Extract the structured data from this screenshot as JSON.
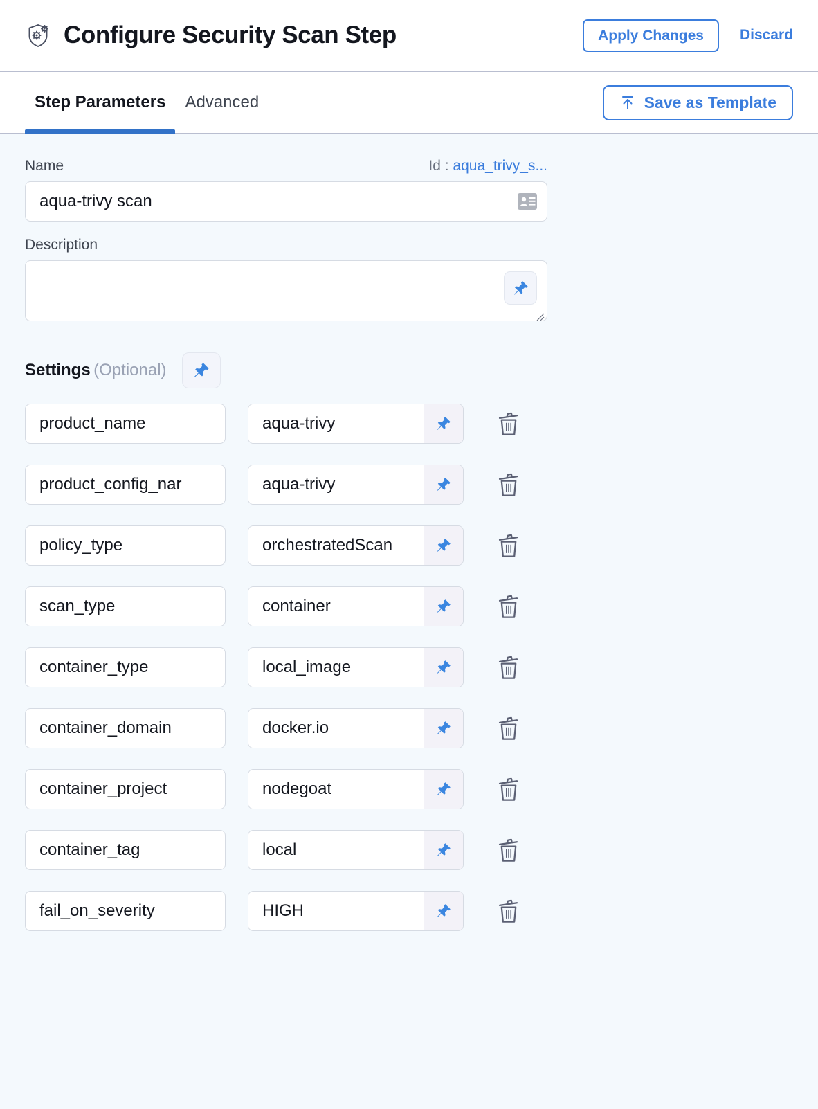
{
  "header": {
    "icon": "shield-gear-icon",
    "title": "Configure Security Scan Step",
    "apply_label": "Apply Changes",
    "discard_label": "Discard"
  },
  "tabbar": {
    "tabs": [
      {
        "label": "Step Parameters",
        "active": true
      },
      {
        "label": "Advanced",
        "active": false
      }
    ],
    "save_template_label": "Save as Template",
    "save_template_icon": "upload-to-top-icon"
  },
  "form": {
    "name": {
      "label": "Name",
      "value": "aqua-trivy scan",
      "placeholder": "",
      "trailing_icon": "id-card-icon"
    },
    "id": {
      "label": "Id :",
      "value": "aqua_trivy_s..."
    },
    "description": {
      "label": "Description",
      "value": "",
      "placeholder": "",
      "pin_icon": "pushpin-icon"
    }
  },
  "settings": {
    "title": "Settings",
    "optional_label": "(Optional)",
    "pin_icon": "pushpin-icon",
    "delete_icon": "trash-icon",
    "rows": [
      {
        "key": "product_name",
        "value": "aqua-trivy"
      },
      {
        "key": "product_config_nar",
        "value": "aqua-trivy"
      },
      {
        "key": "policy_type",
        "value": "orchestratedScan"
      },
      {
        "key": "scan_type",
        "value": "container"
      },
      {
        "key": "container_type",
        "value": "local_image"
      },
      {
        "key": "container_domain",
        "value": "docker.io"
      },
      {
        "key": "container_project",
        "value": "nodegoat"
      },
      {
        "key": "container_tag",
        "value": "local"
      },
      {
        "key": "fail_on_severity",
        "value": "HIGH"
      }
    ]
  },
  "colors": {
    "accent": "#3b7ddd",
    "tab_indicator": "#3272c8",
    "page_bg": "#f4f9fd",
    "panel_bg": "#ffffff",
    "border": "#b9bed0",
    "muted_text": "#9aa2b4"
  }
}
